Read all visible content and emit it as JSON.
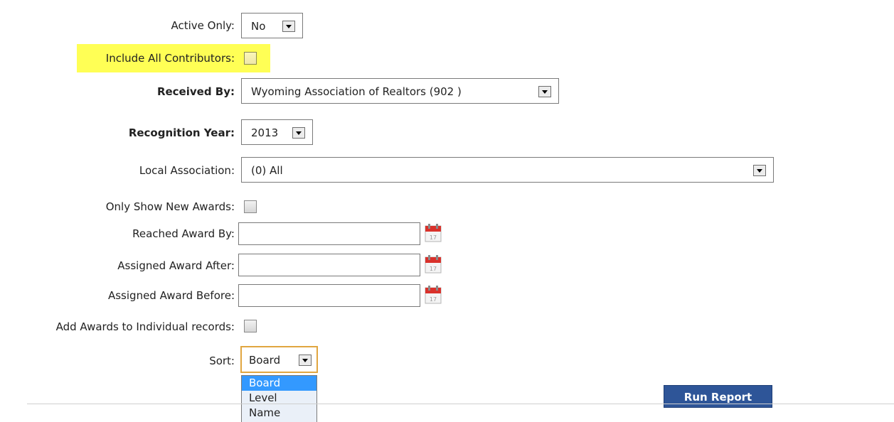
{
  "form": {
    "active_only": {
      "label": "Active Only:",
      "value": "No"
    },
    "include_all_contributors": {
      "label": "Include All Contributors:",
      "checked": false
    },
    "received_by": {
      "label": "Received By:",
      "value": "Wyoming Association of Realtors (902 )"
    },
    "recognition_year": {
      "label": "Recognition Year:",
      "value": "2013"
    },
    "local_association": {
      "label": "Local Association:",
      "value": "(0) All"
    },
    "only_show_new_awards": {
      "label": "Only Show New Awards:",
      "checked": false
    },
    "reached_award_by": {
      "label": "Reached Award By:",
      "value": ""
    },
    "assigned_award_after": {
      "label": "Assigned Award After:",
      "value": ""
    },
    "assigned_award_before": {
      "label": "Assigned Award Before:",
      "value": ""
    },
    "add_awards_to_individual": {
      "label": "Add Awards to Individual records:",
      "checked": false
    },
    "sort": {
      "label": "Sort:",
      "value": "Board",
      "options": [
        "Board",
        "Level",
        "Name"
      ],
      "highlighted_option": "Board"
    }
  },
  "actions": {
    "run_report_label": "Run Report"
  },
  "calendar": {
    "day": "17"
  },
  "colors": {
    "highlight": "#ffff55",
    "button": "#2e5598",
    "focus_border": "#e1a640",
    "selected_option": "#3399ff"
  }
}
